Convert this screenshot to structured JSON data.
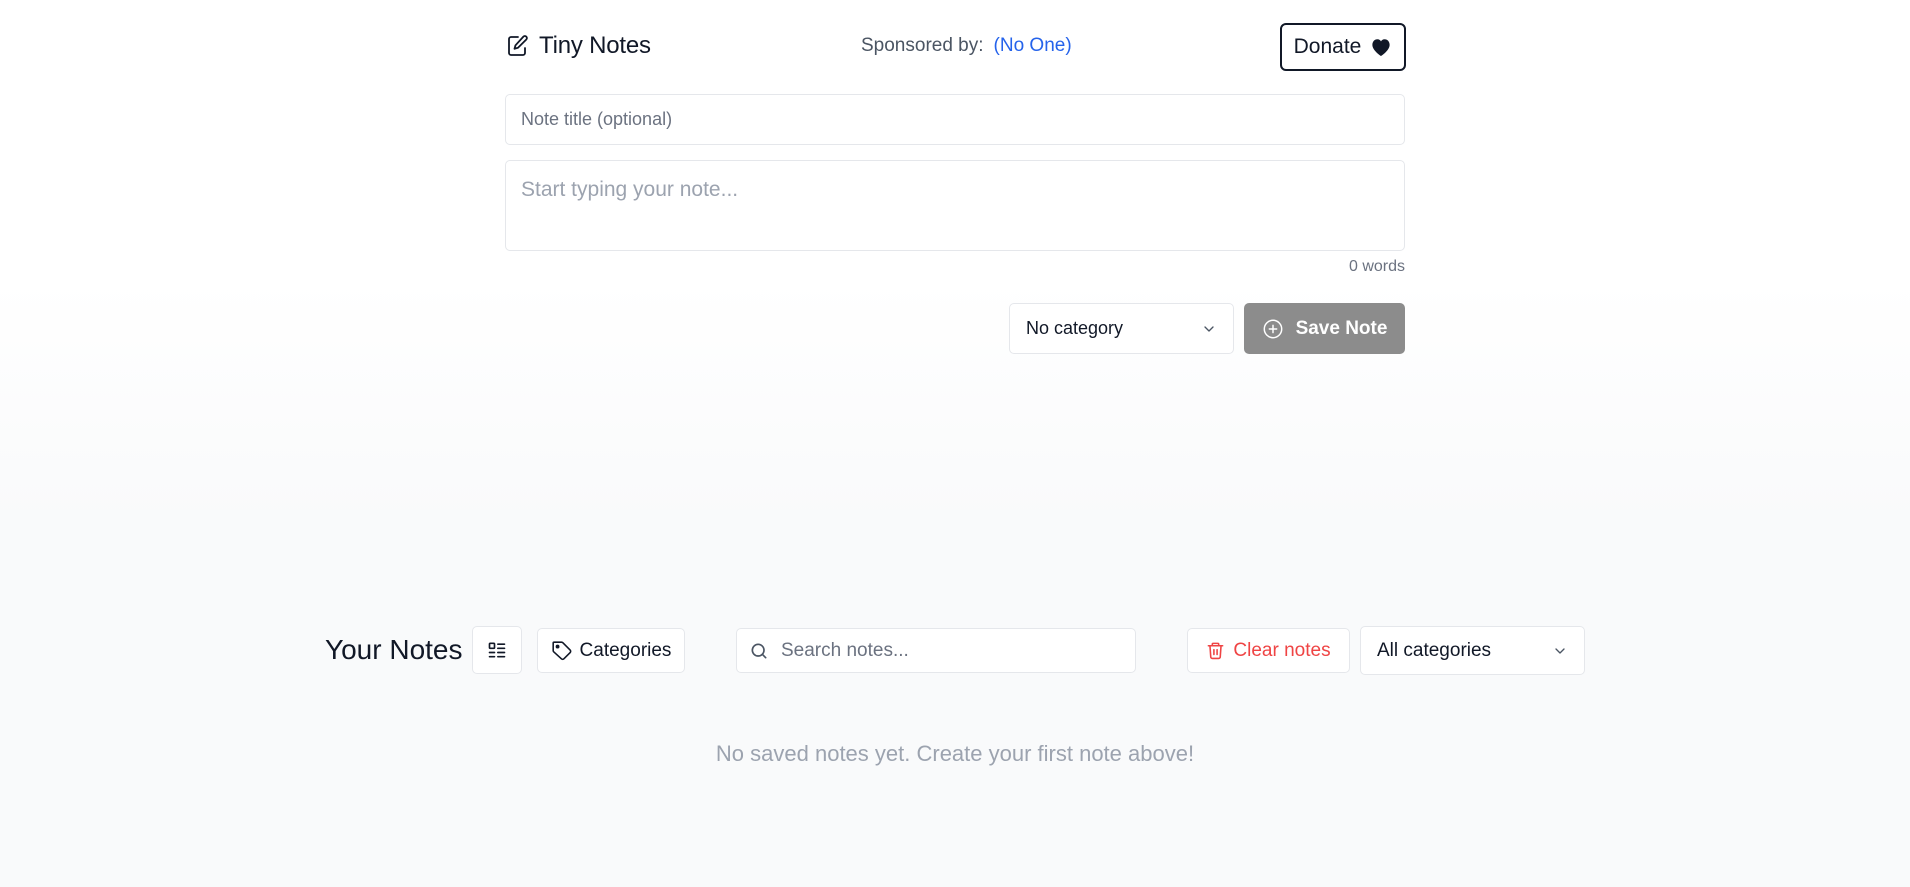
{
  "header": {
    "app_title": "Tiny Notes",
    "app_icon": "edit-note-icon",
    "sponsor_label": "Sponsored by:",
    "sponsor_value": "(No One)",
    "donate_label": "Donate",
    "donate_icon": "heart-icon"
  },
  "editor": {
    "title_placeholder": "Note title (optional)",
    "title_value": "",
    "body_placeholder": "Start typing your note...",
    "body_value": "",
    "word_count": "0 words",
    "category_selected": "No category",
    "save_label": "Save Note",
    "save_icon": "plus-circle-icon"
  },
  "notes": {
    "heading": "Your Notes",
    "view_toggle_icon": "list-view-icon",
    "categories_label": "Categories",
    "categories_icon": "tag-icon",
    "search_placeholder": "Search notes...",
    "search_value": "",
    "clear_label": "Clear notes",
    "clear_icon": "trash-icon",
    "filter_selected": "All categories",
    "empty_message": "No saved notes yet. Create your first note above!"
  },
  "colors": {
    "accent_link": "#2563eb",
    "danger": "#ef4444",
    "save_disabled": "#8c8c8c",
    "border": "#e5e7eb"
  }
}
